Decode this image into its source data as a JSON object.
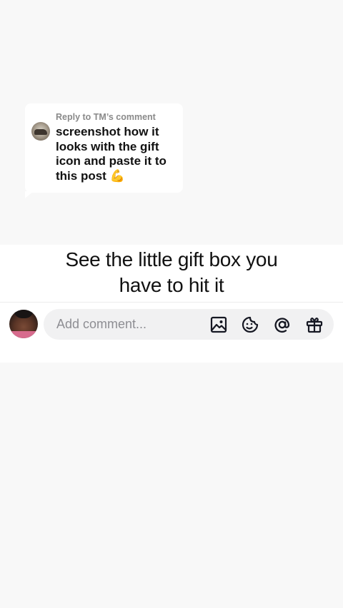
{
  "reply": {
    "header": "Reply to TM’s comment",
    "text": "screenshot how it looks with the gift icon and paste it to this post 💪"
  },
  "caption": {
    "line1": "See the little gift box you",
    "line2": "have to hit it"
  },
  "comment_bar": {
    "placeholder": "Add comment..."
  },
  "icons": [
    "image-icon",
    "sticker-icon",
    "mention-icon",
    "gift-icon"
  ]
}
